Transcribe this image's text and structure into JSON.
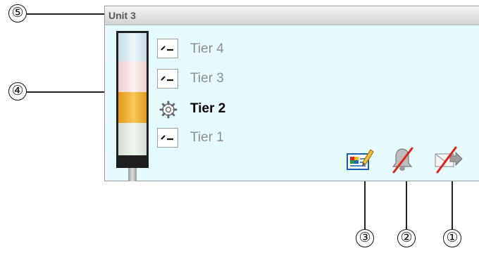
{
  "panel": {
    "title": "Unit 3"
  },
  "tiers": [
    {
      "label": "Tier 4",
      "color": "#d8e9f1",
      "icon": "switch-icon",
      "active": false
    },
    {
      "label": "Tier 3",
      "color": "#f8e1e1",
      "icon": "switch-icon",
      "active": false
    },
    {
      "label": "Tier 2",
      "color": "#f3ad28",
      "icon": "gear-icon",
      "active": true
    },
    {
      "label": "Tier 1",
      "color": "#e4ede2",
      "icon": "switch-icon",
      "active": false
    }
  ],
  "buttons": [
    {
      "icon": "configure-icon"
    },
    {
      "icon": "alarm-bell-disabled-icon"
    },
    {
      "icon": "email-forward-disabled-icon"
    }
  ],
  "callouts": {
    "c1": "①",
    "c2": "②",
    "c3": "③",
    "c4": "④",
    "c5": "⑤"
  }
}
